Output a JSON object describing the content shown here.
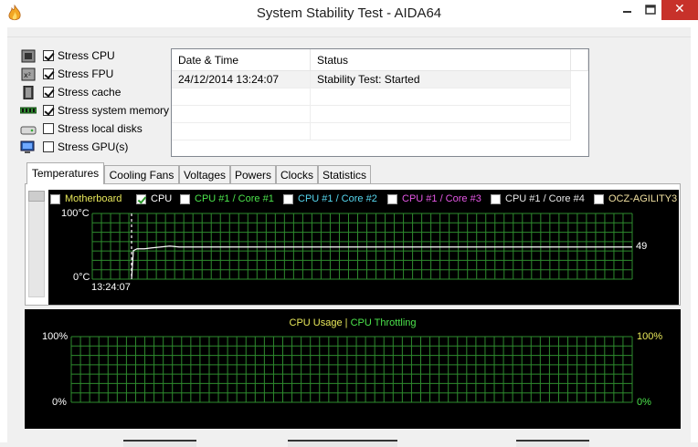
{
  "window": {
    "title": "System Stability Test - AIDA64"
  },
  "stress": [
    {
      "label": "Stress CPU",
      "checked": true,
      "icon": "cpu-icon"
    },
    {
      "label": "Stress FPU",
      "checked": true,
      "icon": "fpu-icon"
    },
    {
      "label": "Stress cache",
      "checked": true,
      "icon": "cache-icon"
    },
    {
      "label": "Stress system memory",
      "checked": true,
      "icon": "memory-icon"
    },
    {
      "label": "Stress local disks",
      "checked": false,
      "icon": "disk-icon"
    },
    {
      "label": "Stress GPU(s)",
      "checked": false,
      "icon": "gpu-icon"
    }
  ],
  "status_table": {
    "headers": [
      "Date & Time",
      "Status"
    ],
    "rows": [
      [
        "24/12/2014 13:24:07",
        "Stability Test: Started"
      ]
    ]
  },
  "tabs": [
    "Temperatures",
    "Cooling Fans",
    "Voltages",
    "Powers",
    "Clocks",
    "Statistics"
  ],
  "active_tab": "Temperatures",
  "temperature_graph": {
    "legend": [
      {
        "label": "Motherboard",
        "checked": false,
        "color": "#e8e85a"
      },
      {
        "label": "CPU",
        "checked": true,
        "color": "#ffffff"
      },
      {
        "label": "CPU #1 / Core #1",
        "checked": false,
        "color": "#4ce44c"
      },
      {
        "label": "CPU #1 / Core #2",
        "checked": false,
        "color": "#57d8f0"
      },
      {
        "label": "CPU #1 / Core #3",
        "checked": false,
        "color": "#e657e6"
      },
      {
        "label": "CPU #1 / Core #4",
        "checked": false,
        "color": "#e8e8e8"
      },
      {
        "label": "OCZ-AGILITY3",
        "checked": false,
        "color": "#f0e0a0"
      }
    ],
    "y_max_label": "100°C",
    "y_min_label": "0°C",
    "x_start_label": "13:24:07",
    "current_value": "49"
  },
  "usage_graph": {
    "title_usage": "CPU Usage",
    "separator": "|",
    "title_throttling": "CPU Throttling",
    "left_max": "100%",
    "left_min": "0%",
    "right_max": "100%",
    "right_min": "0%",
    "usage_color": "#e8e85a",
    "throttling_color": "#4ce44c"
  },
  "chart_data": [
    {
      "type": "line",
      "series": [
        {
          "name": "CPU",
          "x": [
            "13:24:07"
          ],
          "values": [
            49
          ]
        }
      ],
      "ylim": [
        0,
        100
      ]
    },
    {
      "type": "line",
      "series": [
        {
          "name": "CPU Usage",
          "values": []
        },
        {
          "name": "CPU Throttling",
          "values": []
        }
      ],
      "ylim": [
        0,
        100
      ]
    }
  ]
}
